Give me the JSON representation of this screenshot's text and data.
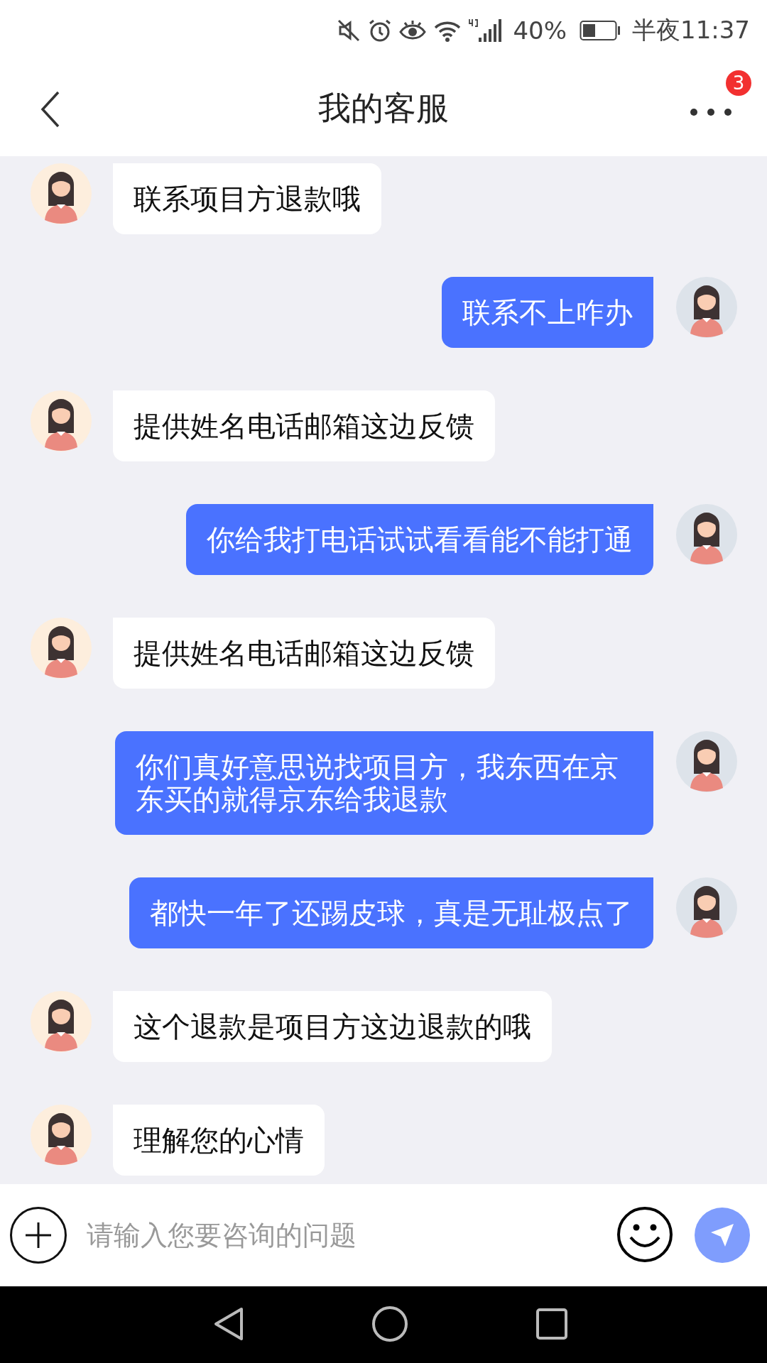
{
  "status_bar": {
    "battery": "40%",
    "time": "半夜11:37"
  },
  "header": {
    "title": "我的客服",
    "badge": "3"
  },
  "messages": [
    {
      "kind": "agent",
      "text": "联系项目方退款哦"
    },
    {
      "kind": "user",
      "text": "联系不上咋办"
    },
    {
      "kind": "agent",
      "text": "提供姓名电话邮箱这边反馈"
    },
    {
      "kind": "user",
      "text": "你给我打电话试试看看能不能打通"
    },
    {
      "kind": "agent",
      "text": "提供姓名电话邮箱这边反馈"
    },
    {
      "kind": "user",
      "text": "你们真好意思说找项目方，我东西在京东买的就得京东给我退款"
    },
    {
      "kind": "user",
      "text": "都快一年了还踢皮球，真是无耻极点了"
    },
    {
      "kind": "agent",
      "text": "这个退款是项目方这边退款的哦"
    },
    {
      "kind": "agent",
      "text": "理解您的心情"
    }
  ],
  "input": {
    "placeholder": "请输入您要咨询的问题"
  }
}
